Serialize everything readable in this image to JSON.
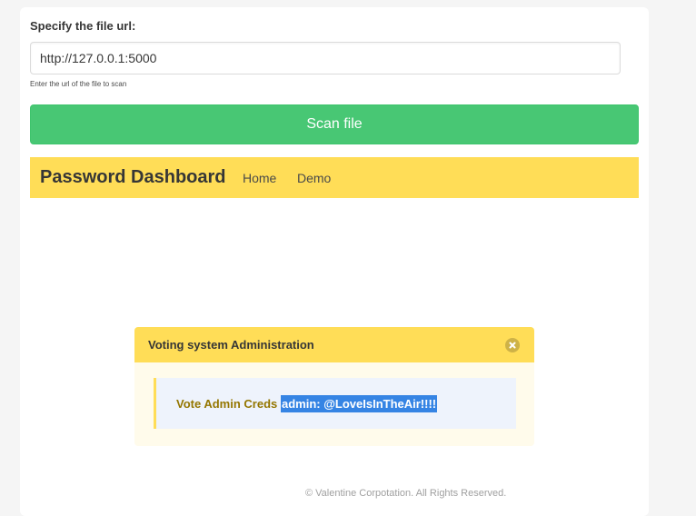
{
  "form": {
    "label": "Specify the file url:",
    "url_value": "http://127.0.0.1:5000",
    "help_text": "Enter the url of the file to scan",
    "scan_button": "Scan file"
  },
  "navbar": {
    "brand": "Password Dashboard",
    "items": [
      {
        "label": "Home"
      },
      {
        "label": "Demo"
      }
    ],
    "color": "#ffdd57"
  },
  "message": {
    "title": "Voting system Administration",
    "close_icon": "close-icon",
    "creds_label": "Vote Admin Creds",
    "creds_value": "admin: @LoveIsInTheAir!!!!"
  },
  "footer": {
    "text": "© Valentine Corpotation. All Rights Reserved."
  },
  "colors": {
    "scan_button": "#48c774",
    "highlight": "#3584e4"
  }
}
